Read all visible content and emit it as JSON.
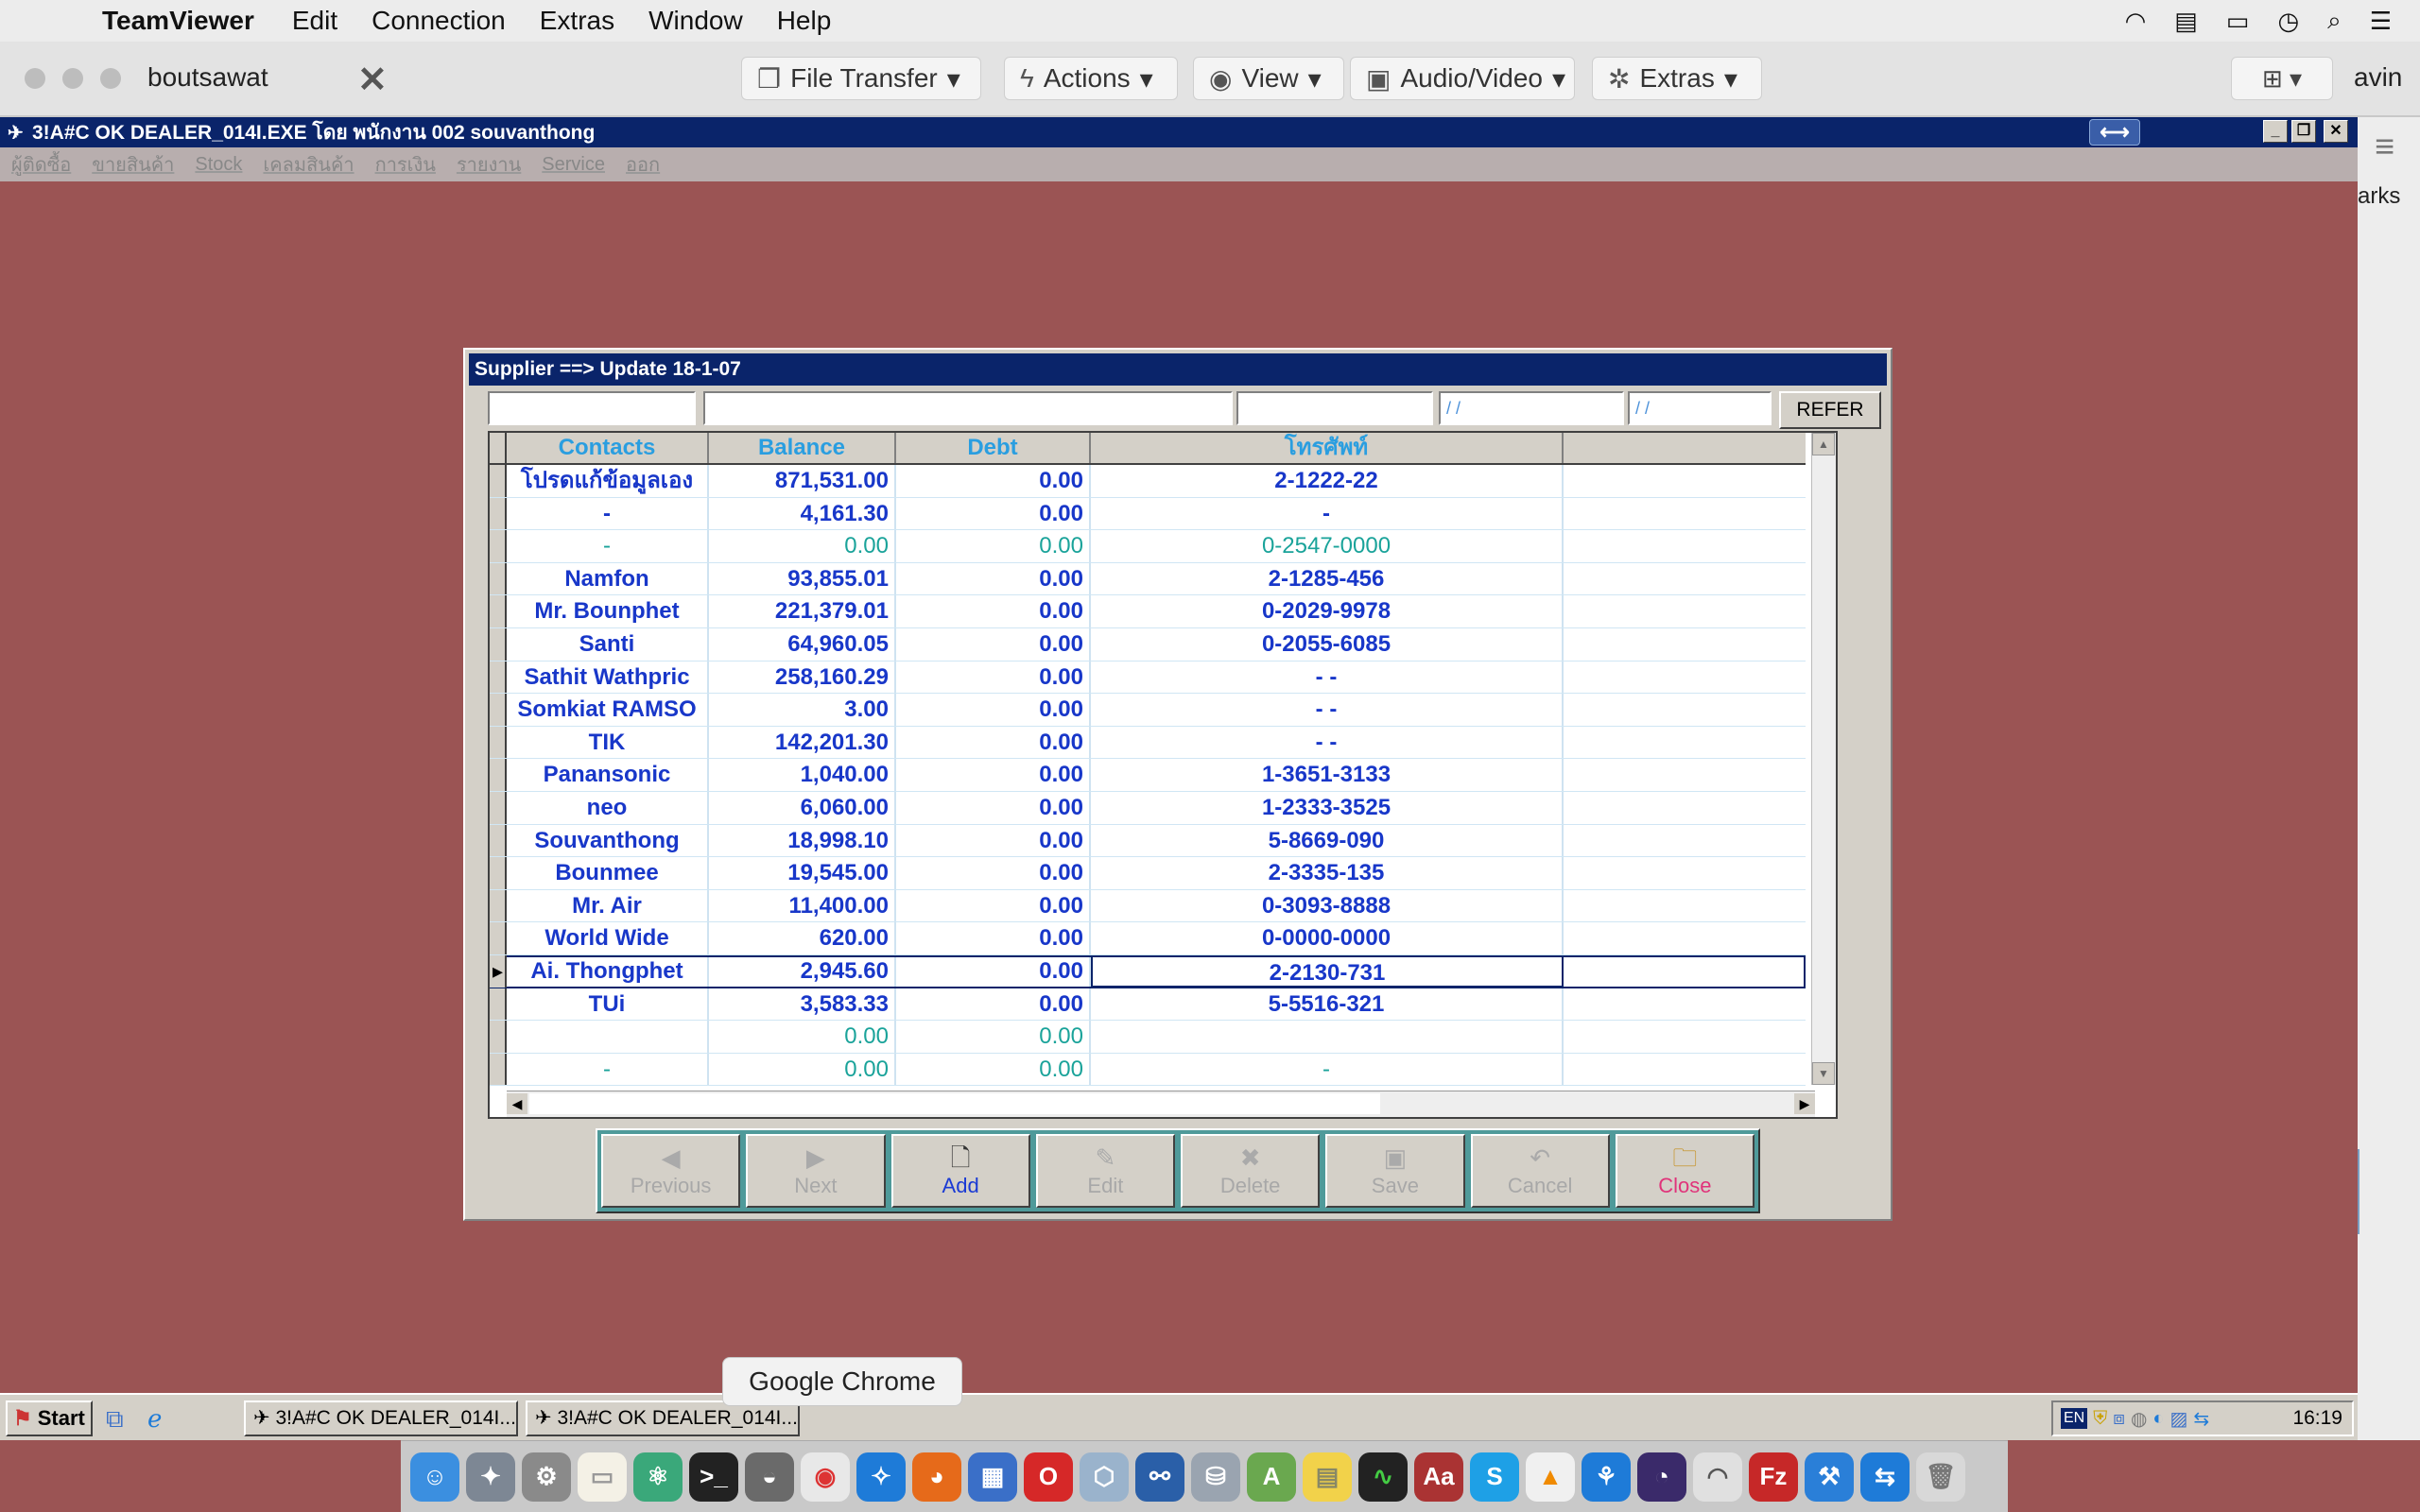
{
  "mac_menubar": {
    "app_name": "TeamViewer",
    "items": [
      "Edit",
      "Connection",
      "Extras",
      "Window",
      "Help"
    ],
    "right_icons": [
      "wifi-icon",
      "flag-icon",
      "battery-icon",
      "clock-icon",
      "search-icon",
      "list-icon"
    ]
  },
  "teamviewer": {
    "partner_name": "boutsawat",
    "toolbar": [
      {
        "label": "File Transfer",
        "icon": "file-transfer-icon"
      },
      {
        "label": "Actions",
        "icon": "lightning-icon"
      },
      {
        "label": "View",
        "icon": "eye-icon"
      },
      {
        "label": "Audio/Video",
        "icon": "chat-icon"
      },
      {
        "label": "Extras",
        "icon": "puzzle-icon"
      }
    ],
    "side_text": "avin",
    "strip_text": "arks"
  },
  "app": {
    "title": "3!A#C OK DEALER_014I.EXE โดย พนักงาน 002 souvanthong",
    "menu": [
      "ผู้ติดซื้อ",
      "ขายสินค้า",
      "Stock",
      "เคลมสินค้า",
      "การเงิน",
      "รายงาน",
      "Service",
      "ออก"
    ]
  },
  "dialog": {
    "title": "Supplier ==> Update 18-1-07",
    "filters": [
      "",
      "",
      "",
      "/ /",
      "/ /"
    ],
    "refer_label": "REFER",
    "columns": [
      "Contacts",
      "Balance",
      "Debt",
      "โทรศัพท์"
    ],
    "rows": [
      {
        "contact": "โปรดแก้ข้อมูลเอง",
        "balance": "871,531.00",
        "debt": "0.00",
        "phone": "2-1222-22",
        "style": "blue"
      },
      {
        "contact": "-",
        "balance": "4,161.30",
        "debt": "0.00",
        "phone": "-",
        "style": "blue"
      },
      {
        "contact": "-",
        "balance": "0.00",
        "debt": "0.00",
        "phone": "0-2547-0000",
        "style": "teal"
      },
      {
        "contact": "Namfon",
        "balance": "93,855.01",
        "debt": "0.00",
        "phone": "2-1285-456",
        "style": "blue"
      },
      {
        "contact": "Mr. Bounphet",
        "balance": "221,379.01",
        "debt": "0.00",
        "phone": "0-2029-9978",
        "style": "blue"
      },
      {
        "contact": "Santi",
        "balance": "64,960.05",
        "debt": "0.00",
        "phone": "0-2055-6085",
        "style": "blue"
      },
      {
        "contact": "Sathit Wathpric",
        "balance": "258,160.29",
        "debt": "0.00",
        "phone": "-   -",
        "style": "blue"
      },
      {
        "contact": "Somkiat RAMSO",
        "balance": "3.00",
        "debt": "0.00",
        "phone": "-   -",
        "style": "blue"
      },
      {
        "contact": "TIK",
        "balance": "142,201.30",
        "debt": "0.00",
        "phone": "-   -",
        "style": "blue"
      },
      {
        "contact": "Panansonic",
        "balance": "1,040.00",
        "debt": "0.00",
        "phone": "1-3651-3133",
        "style": "blue"
      },
      {
        "contact": "neo",
        "balance": "6,060.00",
        "debt": "0.00",
        "phone": "1-2333-3525",
        "style": "blue"
      },
      {
        "contact": "Souvanthong",
        "balance": "18,998.10",
        "debt": "0.00",
        "phone": "5-8669-090",
        "style": "blue"
      },
      {
        "contact": "Bounmee",
        "balance": "19,545.00",
        "debt": "0.00",
        "phone": "2-3335-135",
        "style": "blue"
      },
      {
        "contact": "Mr. Air",
        "balance": "11,400.00",
        "debt": "0.00",
        "phone": "0-3093-8888",
        "style": "blue"
      },
      {
        "contact": "World Wide",
        "balance": "620.00",
        "debt": "0.00",
        "phone": "0-0000-0000",
        "style": "blue"
      },
      {
        "contact": "Ai. Thongphet",
        "balance": "2,945.60",
        "debt": "0.00",
        "phone": "2-2130-731",
        "style": "blue",
        "selected": true
      },
      {
        "contact": "TUi",
        "balance": "3,583.33",
        "debt": "0.00",
        "phone": "5-5516-321",
        "style": "blue"
      },
      {
        "contact": "",
        "balance": "0.00",
        "debt": "0.00",
        "phone": "",
        "style": "teal"
      },
      {
        "contact": "-",
        "balance": "0.00",
        "debt": "0.00",
        "phone": "-",
        "style": "teal"
      }
    ],
    "buttons": [
      {
        "label": "Previous",
        "icon": "previous-icon",
        "enabled": false
      },
      {
        "label": "Next",
        "icon": "next-icon",
        "enabled": false
      },
      {
        "label": "Add",
        "icon": "new-document-icon",
        "enabled": true
      },
      {
        "label": "Edit",
        "icon": "edit-icon",
        "enabled": false
      },
      {
        "label": "Delete",
        "icon": "delete-icon",
        "enabled": false
      },
      {
        "label": "Save",
        "icon": "save-icon",
        "enabled": false
      },
      {
        "label": "Cancel",
        "icon": "undo-icon",
        "enabled": false
      },
      {
        "label": "Close",
        "icon": "folder-icon",
        "enabled": true
      }
    ]
  },
  "taskbar": {
    "start_label": "Start",
    "tasks": [
      "3!A#C OK DEALER_014I...",
      "3!A#C OK DEALER_014I..."
    ],
    "tray_lang": "EN",
    "clock": "16:19"
  },
  "tooltip": "Google Chrome",
  "colors": {
    "desktop": "#9b5454",
    "titlebar": "#0a246a",
    "grid_text": "#1837c9",
    "grid_header": "#2a9ee0",
    "teal_text": "#1aa39a"
  }
}
